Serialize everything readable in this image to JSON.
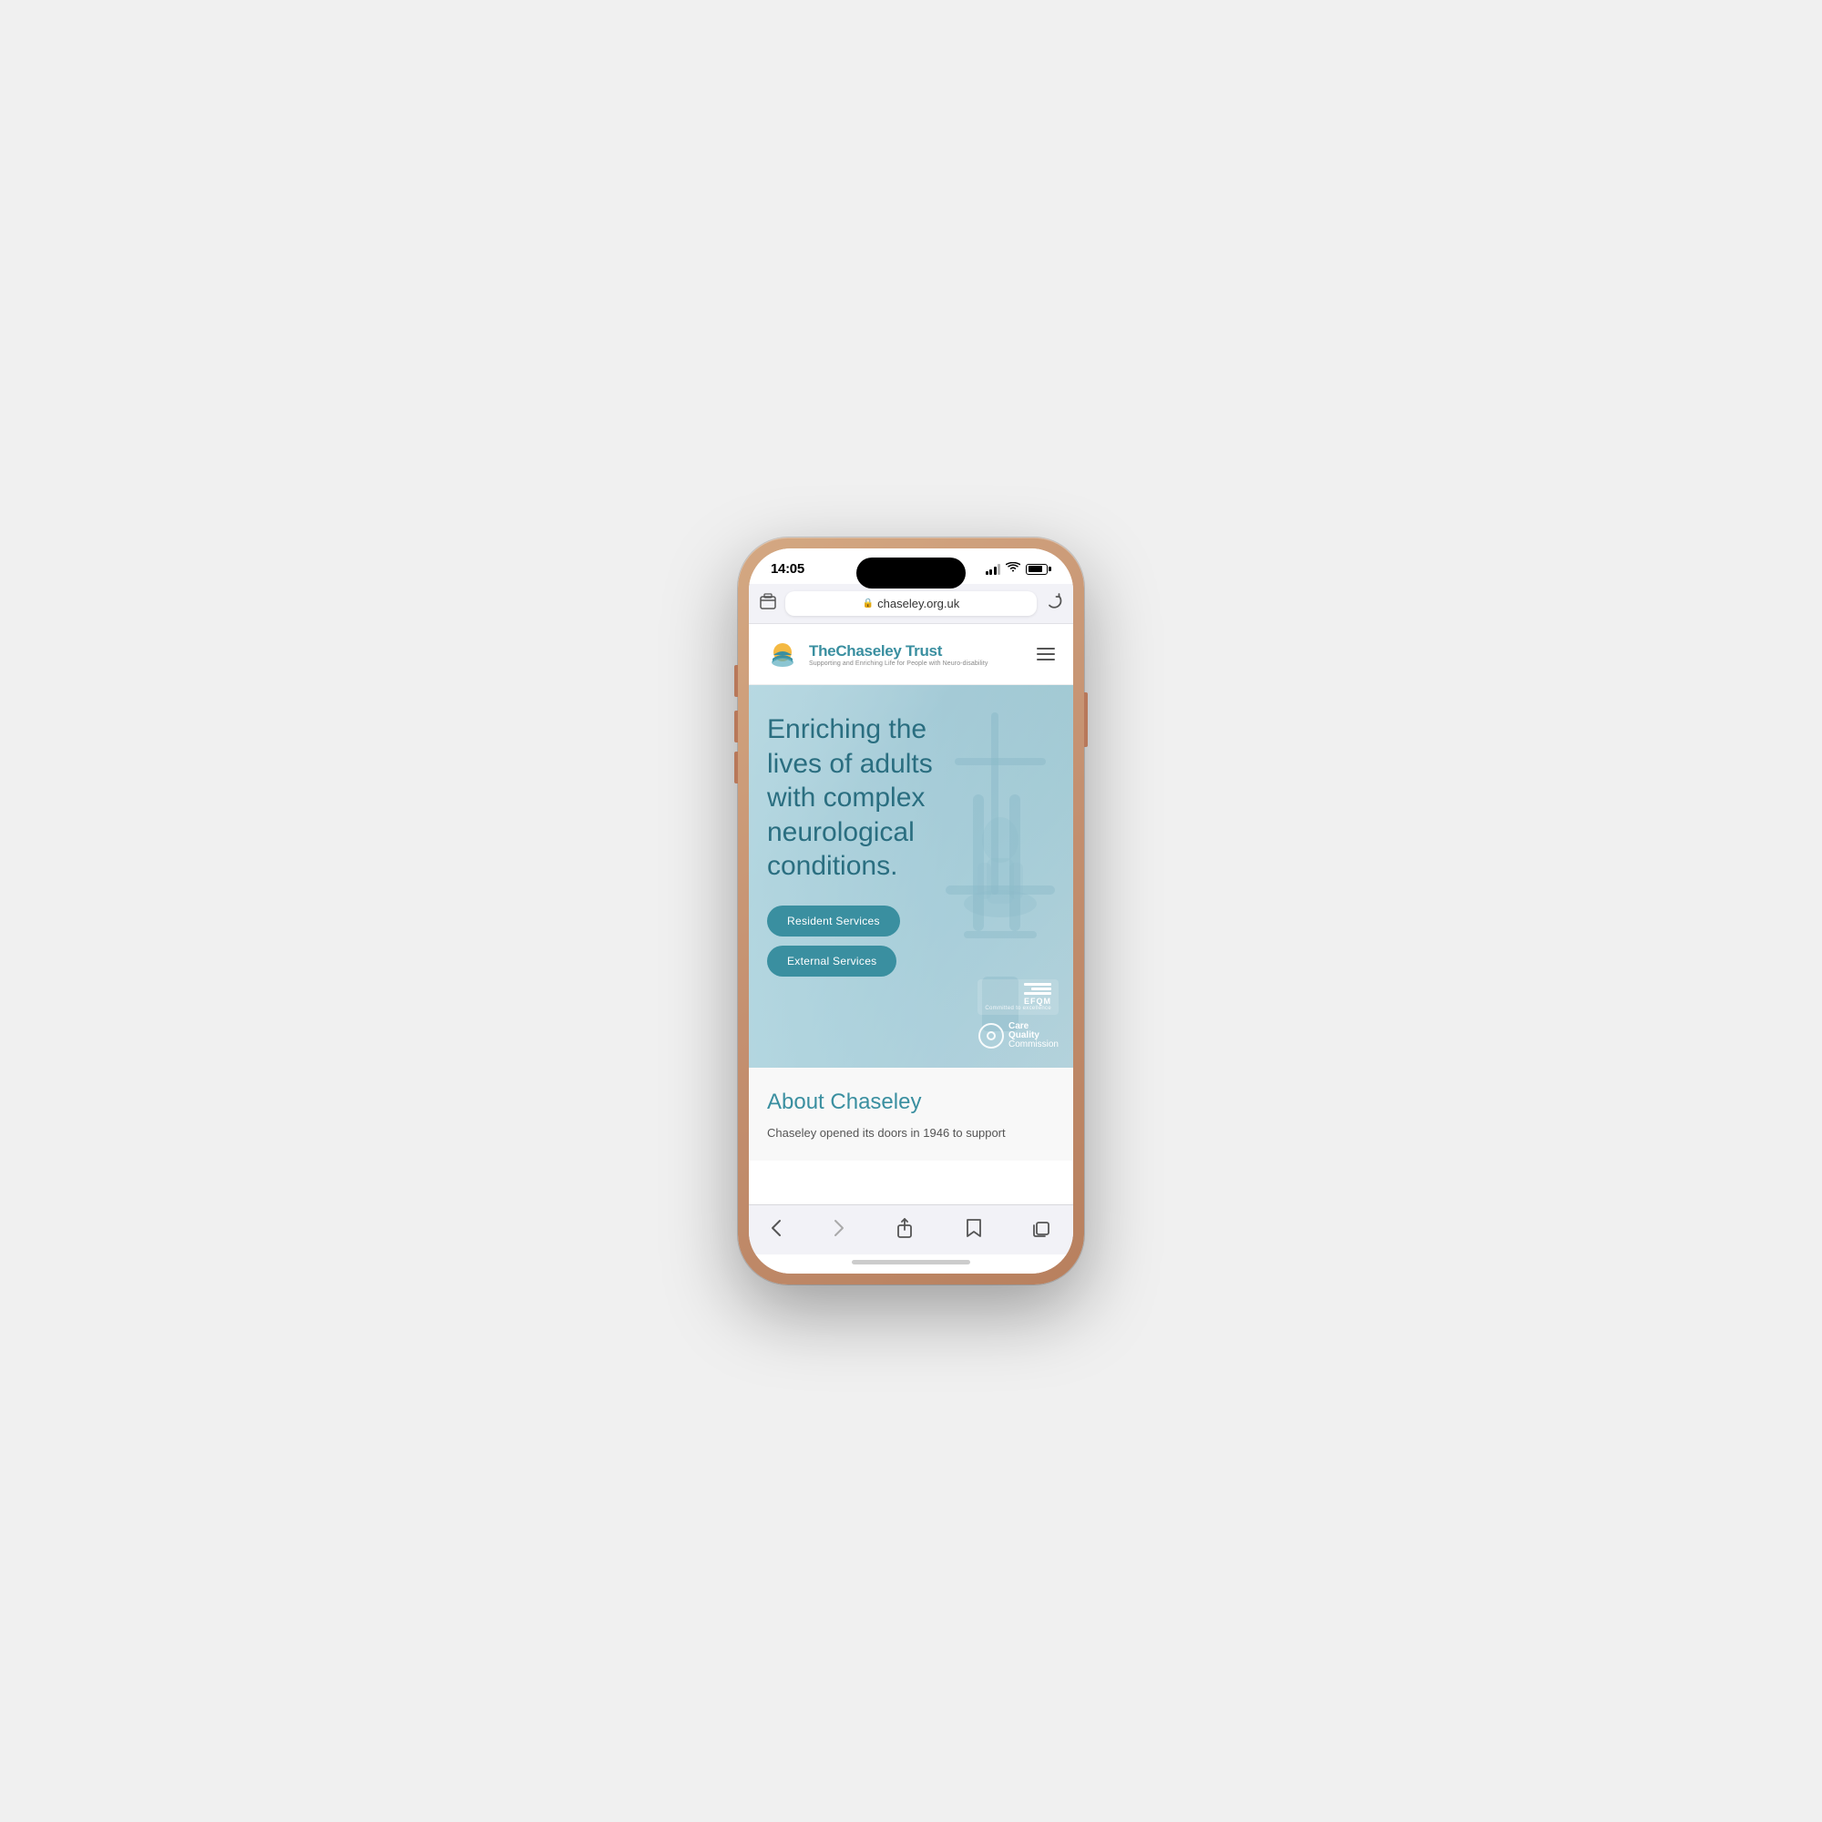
{
  "phone": {
    "status_bar": {
      "time": "14:05",
      "signal_label": "signal",
      "wifi_label": "wifi",
      "battery_label": "battery"
    },
    "browser": {
      "url": "chaseley.org.uk",
      "tab_icon": "⊞",
      "refresh_icon": "↻"
    },
    "website": {
      "nav": {
        "logo_title": "TheChaseley Trust",
        "logo_subtitle": "Supporting and Enriching Life for People with Neuro-disability",
        "menu_label": "menu"
      },
      "hero": {
        "title": "Enriching the lives of adults with complex neurological conditions.",
        "btn_resident": "Resident Services",
        "btn_external": "External Services",
        "efqm_text": "EFQM",
        "efqm_sub": "Committed to excellence",
        "cqc_care": "Care",
        "cqc_quality": "Quality",
        "cqc_commission": "Commission"
      },
      "about": {
        "title": "About Chaseley",
        "text": "Chaseley opened its doors in 1946 to support"
      }
    },
    "toolbar": {
      "back_label": "<",
      "forward_label": ">",
      "share_label": "share",
      "bookmark_label": "bookmark",
      "tabs_label": "tabs"
    }
  }
}
